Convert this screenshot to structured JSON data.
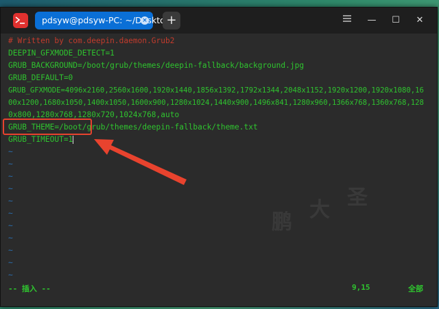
{
  "titlebar": {
    "tab_title": "pdsyw@pdsyw-PC: ~/Desktop",
    "tab_close": "×",
    "new_tab": "+",
    "minimize": "—",
    "maximize": "☐",
    "close": "✕"
  },
  "editor": {
    "lines": [
      "# Written by com.deepin.daemon.Grub2",
      "DEEPIN_GFXMODE_DETECT=1",
      "GRUB_BACKGROUND=/boot/grub/themes/deepin-fallback/background.jpg",
      "GRUB_DEFAULT=0",
      "GRUB_GFXMODE=4096x2160,2560x1600,1920x1440,1856x1392,1792x1344,2048x1152,1920x1200,1920x1080,16",
      "00x1200,1680x1050,1400x1050,1600x900,1280x1024,1440x900,1496x841,1280x960,1366x768,1360x768,128",
      "0x800,1280x768,1280x720,1024x768,auto",
      "GRUB_THEME=/boot/grub/themes/deepin-fallback/theme.txt",
      "GRUB_TIMEOUT=1"
    ],
    "tilde": "~",
    "mode": "-- 插入 --",
    "position": "9,15",
    "scroll": "全部"
  },
  "colors": {
    "text": "#2fc42f",
    "comment": "#c23b2c",
    "tilde": "#2a6fb0",
    "tab_active": "#0a6fd6",
    "annotation": "#e8432e"
  },
  "watermark": [
    "鹏",
    "大",
    "圣"
  ]
}
